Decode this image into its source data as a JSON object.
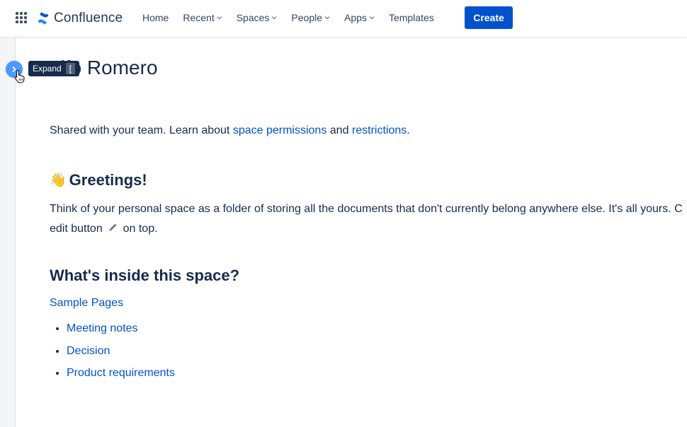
{
  "header": {
    "brand": "Confluence",
    "nav": [
      {
        "label": "Home",
        "dropdown": false
      },
      {
        "label": "Recent",
        "dropdown": true
      },
      {
        "label": "Spaces",
        "dropdown": true
      },
      {
        "label": "People",
        "dropdown": true
      },
      {
        "label": "Apps",
        "dropdown": true
      },
      {
        "label": "Templates",
        "dropdown": false
      }
    ],
    "create_label": "Create"
  },
  "sidebar": {
    "expand_tooltip": "Expand",
    "expand_shortcut": "["
  },
  "page": {
    "title": "olfo Romero",
    "intro": {
      "prefix": "Shared with your team. Learn about ",
      "link1": "space permissions",
      "middle": " and ",
      "link2": "restrictions",
      "suffix": "."
    },
    "greeting": {
      "emoji": "👋",
      "heading": "Greetings!"
    },
    "paragraph": {
      "line1": "Think of your personal space as a folder of storing all the documents that don't currently belong anywhere else. It's all yours. C",
      "line2_before": "edit button ",
      "line2_after": " on top."
    },
    "inside_heading": "What's inside this space?",
    "sample_pages": "Sample Pages",
    "pages": [
      "Meeting notes",
      "Decision",
      "Product requirements"
    ]
  },
  "colors": {
    "primary": "#0052cc",
    "text": "#172b4d",
    "expand_button": "#4c9aff",
    "tooltip_bg": "#172b4d"
  },
  "icons": [
    "app-switcher-icon",
    "confluence-logo-icon",
    "chevron-down-icon",
    "chevron-right-icon",
    "pencil-icon",
    "pointer-cursor-icon"
  ]
}
